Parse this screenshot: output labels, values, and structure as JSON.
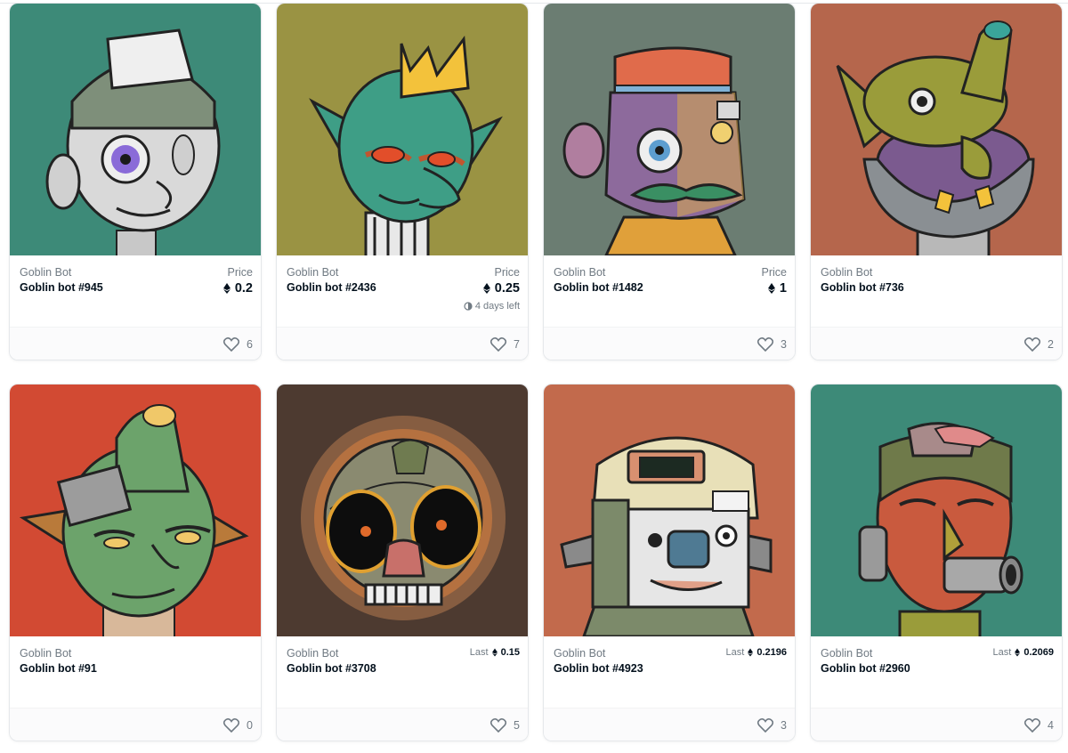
{
  "cards": [
    {
      "collection": "Goblin Bot",
      "token": "Goblin bot #945",
      "price_label": "Price",
      "price": "0.2",
      "likes": "6",
      "bg": "#3d8a78"
    },
    {
      "collection": "Goblin Bot",
      "token": "Goblin bot #2436",
      "price_label": "Price",
      "price": "0.25",
      "time_left": "4 days left",
      "likes": "7",
      "bg": "#9a9343"
    },
    {
      "collection": "Goblin Bot",
      "token": "Goblin bot #1482",
      "price_label": "Price",
      "price": "1",
      "likes": "3",
      "bg": "#6b7d72"
    },
    {
      "collection": "Goblin Bot",
      "token": "Goblin bot #736",
      "likes": "2",
      "bg": "#b5664c"
    },
    {
      "collection": "Goblin Bot",
      "token": "Goblin bot #91",
      "likes": "0",
      "bg": "#d24a33"
    },
    {
      "collection": "Goblin Bot",
      "token": "Goblin bot #3708",
      "last_label": "Last",
      "last_price": "0.15",
      "likes": "5",
      "bg": "#4d3a30"
    },
    {
      "collection": "Goblin Bot",
      "token": "Goblin bot #4923",
      "last_label": "Last",
      "last_price": "0.2196",
      "likes": "3",
      "bg": "#c26a4c"
    },
    {
      "collection": "Goblin Bot",
      "token": "Goblin bot #2960",
      "last_label": "Last",
      "last_price": "0.2069",
      "likes": "4",
      "bg": "#3d8a78"
    }
  ]
}
